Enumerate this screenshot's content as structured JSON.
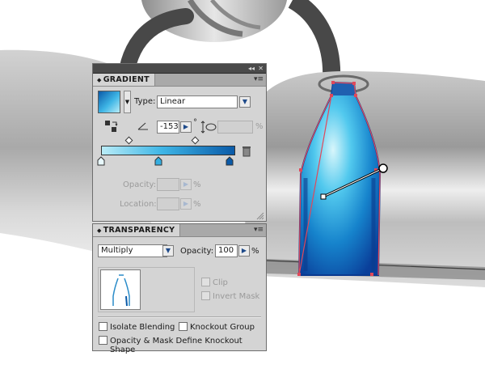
{
  "colors": {
    "panel_bg": "#d4d4d4",
    "gradient_start": "#b9ecf7",
    "gradient_end": "#0a5aa8",
    "selection_color": "#e0485a",
    "artwork_gray": "#4a4a4a"
  },
  "gradient_panel": {
    "title": "GRADIENT",
    "type_label": "Type:",
    "type_value": "Linear",
    "angle_value": "-153",
    "degree_symbol": "°",
    "percent_symbol": "%",
    "opacity_label": "Opacity:",
    "location_label": "Location:"
  },
  "transparency_panel": {
    "title": "TRANSPARENCY",
    "blend_mode": "Multiply",
    "opacity_label": "Opacity:",
    "opacity_value": "100",
    "percent_symbol": "%",
    "clip_label": "Clip",
    "invert_mask_label": "Invert Mask",
    "isolate_blending_label": "Isolate Blending",
    "knockout_group_label": "Knockout Group",
    "opacity_mask_label": "Opacity & Mask Define Knockout Shape"
  }
}
